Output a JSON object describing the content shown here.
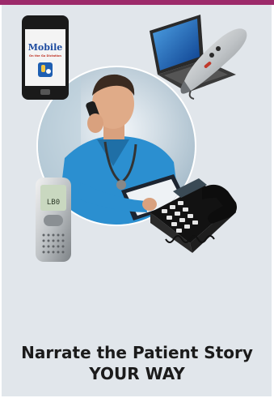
{
  "colors": {
    "top_bar": "#9c2a6a",
    "panel_bg": "#e1e6eb",
    "caption_text": "#1b1b1b",
    "scrub_blue": "#2b8fd0"
  },
  "phone_app": {
    "logo_text": "Mobile",
    "tagline": "On the Go Dictation"
  },
  "recorder": {
    "screen_text": "LB0"
  },
  "caption": {
    "line1": "Narrate the Patient Story",
    "line2": "YOUR WAY"
  },
  "icons": [
    "smartphone-icon",
    "laptop-icon",
    "dictation-mic-icon",
    "digital-recorder-icon",
    "desk-phone-icon"
  ]
}
